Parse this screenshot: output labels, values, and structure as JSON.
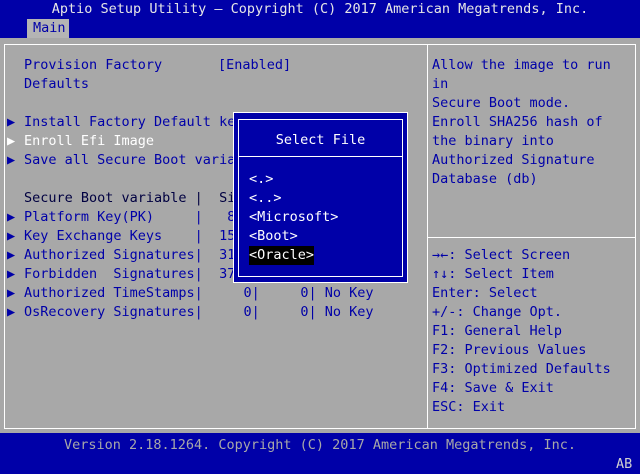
{
  "title": "Aptio Setup Utility – Copyright (C) 2017 American Megatrends, Inc.",
  "tab": "Main",
  "left": {
    "provision_label": "Provision Factory",
    "provision_label2": "Defaults",
    "provision_value": "[Enabled]",
    "menu1": "Install Factory Default ke",
    "menu2": "Enroll Efi Image",
    "menu3": "Save all Secure Boot varia",
    "var_header": "Secure Boot variable |  Si",
    "rows": [
      {
        "arrow": "▶",
        "text": "Platform Key(PK)     |   8"
      },
      {
        "arrow": "▶",
        "text": "Key Exchange Keys    |  15"
      },
      {
        "arrow": "▶",
        "text": "Authorized Signatures|  31"
      },
      {
        "arrow": "▶",
        "text": "Forbidden  Signatures|  37"
      },
      {
        "arrow": "▶",
        "text": "Authorized TimeStamps|     0|     0| No Key"
      },
      {
        "arrow": "▶",
        "text": "OsRecovery Signatures|     0|     0| No Key"
      }
    ]
  },
  "help": {
    "l1": "Allow the image to run",
    "l2": "in",
    "l3": "Secure Boot mode.",
    "l4": "Enroll SHA256 hash of",
    "l5": "the binary into",
    "l6": "Authorized Signature",
    "l7": "Database (db)"
  },
  "keys": [
    "→←: Select Screen",
    "↑↓: Select Item",
    "Enter: Select",
    "+/-: Change Opt.",
    "F1: General Help",
    "F2: Previous Values",
    "F3: Optimized Defaults",
    "F4: Save & Exit",
    "ESC: Exit"
  ],
  "dialog": {
    "title": "Select File",
    "options": [
      "<.>",
      "<..>",
      "<Microsoft>",
      "<Boot>",
      "<Oracle>"
    ]
  },
  "version": "Version 2.18.1264. Copyright (C) 2017 American Megatrends, Inc.",
  "corner": "AB"
}
